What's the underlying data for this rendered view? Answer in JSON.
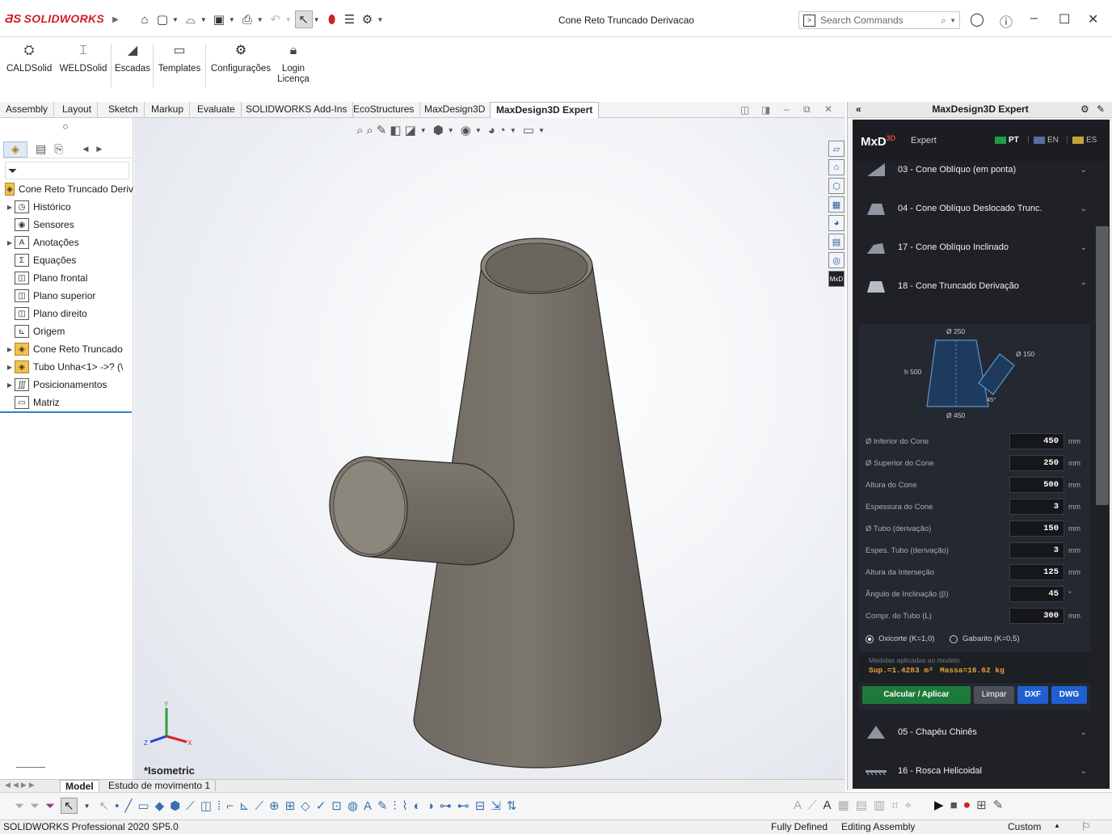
{
  "app": {
    "logo_brand": "SOLIDWORKS",
    "document_title": "Cone Reto Truncado Derivacao",
    "search_placeholder": "Search Commands"
  },
  "ribbon": {
    "buttons": [
      {
        "label": "CALDSolid"
      },
      {
        "label": "WELDSolid"
      },
      {
        "label": "Escadas"
      },
      {
        "label": "Templates"
      },
      {
        "label": "Configurações"
      },
      {
        "label": "Login\nLicença"
      }
    ]
  },
  "tabs": [
    "Assembly",
    "Layout",
    "Sketch",
    "Markup",
    "Evaluate",
    "SOLIDWORKS Add-Ins",
    "EcoStructures",
    "MaxDesign3D",
    "MaxDesign3D Expert"
  ],
  "active_tab": "MaxDesign3D Expert",
  "tree": {
    "root": "Cone Reto Truncado Deriv",
    "items": [
      {
        "label": "Histórico",
        "expandable": true
      },
      {
        "label": "Sensores",
        "expandable": false
      },
      {
        "label": "Anotações",
        "expandable": true
      },
      {
        "label": "Equações",
        "expandable": false
      },
      {
        "label": "Plano frontal",
        "expandable": false
      },
      {
        "label": "Plano superior",
        "expandable": false
      },
      {
        "label": "Plano direito",
        "expandable": false
      },
      {
        "label": "Origem",
        "expandable": false
      },
      {
        "label": "Cone Reto Truncado",
        "expandable": true
      },
      {
        "label": "Tubo Unha<1> ->? (\\",
        "expandable": true
      },
      {
        "label": "Posicionamentos",
        "expandable": true
      },
      {
        "label": "Matriz",
        "expandable": false
      }
    ]
  },
  "viewport": {
    "view_label": "*Isometric",
    "axes": {
      "x": "X",
      "y": "Y",
      "z": "Z"
    }
  },
  "model_tabs": [
    "Model",
    "Estudo de movimento 1"
  ],
  "status": {
    "product": "SOLIDWORKS Professional 2020 SP5.0",
    "defined": "Fully Defined",
    "mode": "Editing Assembly",
    "units": "Custom"
  },
  "panel": {
    "title": "MaxDesign3D Expert",
    "brand": "MxD",
    "brand_sup": "3D",
    "subtitle": "Expert",
    "languages": [
      "PT",
      "EN",
      "ES"
    ],
    "active_language": "PT",
    "accordion": [
      {
        "label": "03 - Cone Oblíquo (em ponta)",
        "open": false
      },
      {
        "label": "04 - Cone Oblíquo Deslocado Trunc.",
        "open": false
      },
      {
        "label": "17 - Cone Oblíquo Inclinado",
        "open": false
      },
      {
        "label": "18 - Cone Truncado Derivação",
        "open": true
      },
      {
        "label": "05 - Chapéu Chinês",
        "open": false
      },
      {
        "label": "16 - Rosca Helicoidal",
        "open": false
      }
    ],
    "diagram": {
      "top_dia": "Ø 250",
      "bottom_dia": "Ø 450",
      "height": "h 500",
      "tube_dia": "Ø 150",
      "angle": "45°"
    },
    "fields": [
      {
        "label": "Ø Inferior do Cone",
        "value": "450",
        "unit": "mm"
      },
      {
        "label": "Ø Superior do Cone",
        "value": "250",
        "unit": "mm"
      },
      {
        "label": "Altura do Cone",
        "value": "500",
        "unit": "mm"
      },
      {
        "label": "Espessura do Cone",
        "value": "3",
        "unit": "mm"
      },
      {
        "label": "Ø Tubo (derivação)",
        "value": "150",
        "unit": "mm"
      },
      {
        "label": "Espes. Tubo (derivação)",
        "value": "3",
        "unit": "mm"
      },
      {
        "label": "Altura da Interseção",
        "value": "125",
        "unit": "mm"
      },
      {
        "label": "Ângulo de Inclinação (β)",
        "value": "45",
        "unit": "°"
      },
      {
        "label": "Compr. do Tubo (L)",
        "value": "300",
        "unit": "mm"
      }
    ],
    "radio": [
      {
        "label": "Oxicorte (K=1,0)",
        "checked": true
      },
      {
        "label": "Gabarito (K=0,5)",
        "checked": false
      }
    ],
    "result_note": "Medidas aplicadas ao modelo.",
    "result_area": "Sup.=1.4283 m²",
    "result_mass": "Massa=16.62 kg",
    "buttons": {
      "apply": "Calcular / Aplicar",
      "clear": "Limpar",
      "dxf": "DXF",
      "dwg": "DWG"
    },
    "colors": {
      "apply": "#1e7a3a",
      "clear": "#4a4f58",
      "export": "#1f5fd1",
      "result": "#e5a23a"
    }
  }
}
